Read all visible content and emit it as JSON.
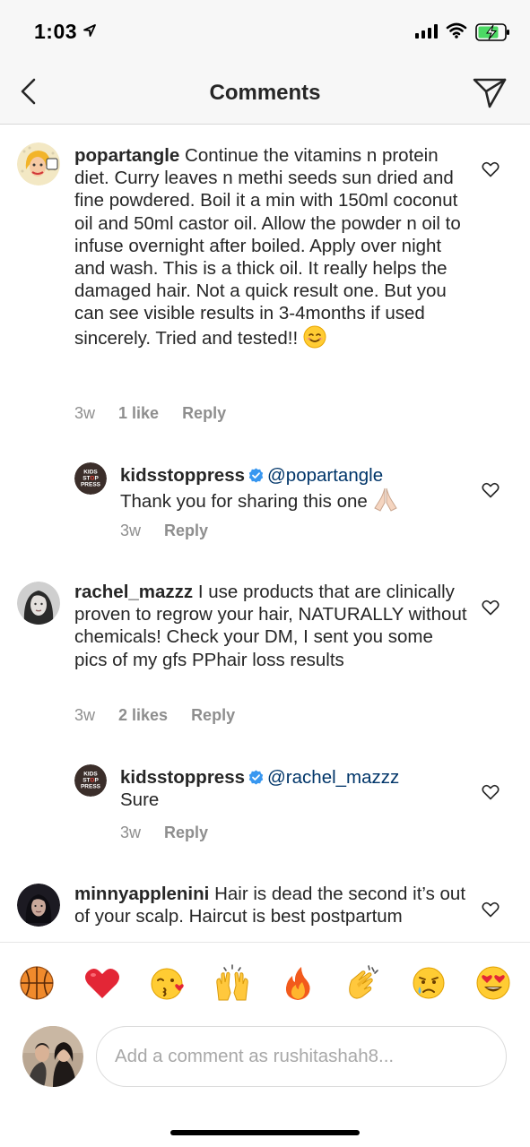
{
  "status_bar": {
    "time": "1:03"
  },
  "header": {
    "title": "Comments"
  },
  "comments": [
    {
      "username": "popartangle",
      "text": "Continue the vitamins n protein diet.  Curry leaves n methi seeds sun dried and fine powdered.  Boil it a min with 150ml coconut oil  and 50ml castor oil. Allow the powder n oil to infuse overnight after boiled. Apply over night and wash. This is a thick oil. It really helps the damaged hair.  Not a quick result one.  But you can see visible results in 3-4months if used sincerely. Tried and tested!!",
      "time": "3w",
      "likes": "1 like",
      "reply": "Reply"
    },
    {
      "username": "kidsstoppress",
      "mention": "@popartangle",
      "text": "Thank you for sharing this one",
      "time": "3w",
      "reply": "Reply"
    },
    {
      "username": "rachel_mazzz",
      "text": "I use products that are clinically proven to regrow your hair, NATURALLY without chemicals! Check your DM, I sent you some pics of my gfs PPhair loss results",
      "time": "3w",
      "likes": "2 likes",
      "reply": "Reply"
    },
    {
      "username": "kidsstoppress",
      "mention": "@rachel_mazzz",
      "text": "Sure",
      "time": "3w",
      "reply": "Reply"
    },
    {
      "username": "minnyapplenini",
      "text": "Hair is dead the second it’s out of your scalp. Haircut is best postpartum"
    }
  ],
  "emoji_bar": [
    "basketball",
    "red-heart",
    "face-blowing-kiss",
    "raising-hands",
    "fire",
    "clapping-hands",
    "crying-face",
    "heart-eyes"
  ],
  "composer": {
    "placeholder": "Add a comment as rushitashah8..."
  },
  "colors": {
    "text": "#262626",
    "secondary": "#8e8e8e",
    "mention": "#003569",
    "verified": "#3897f0",
    "header_bg": "#f7f7f7"
  }
}
